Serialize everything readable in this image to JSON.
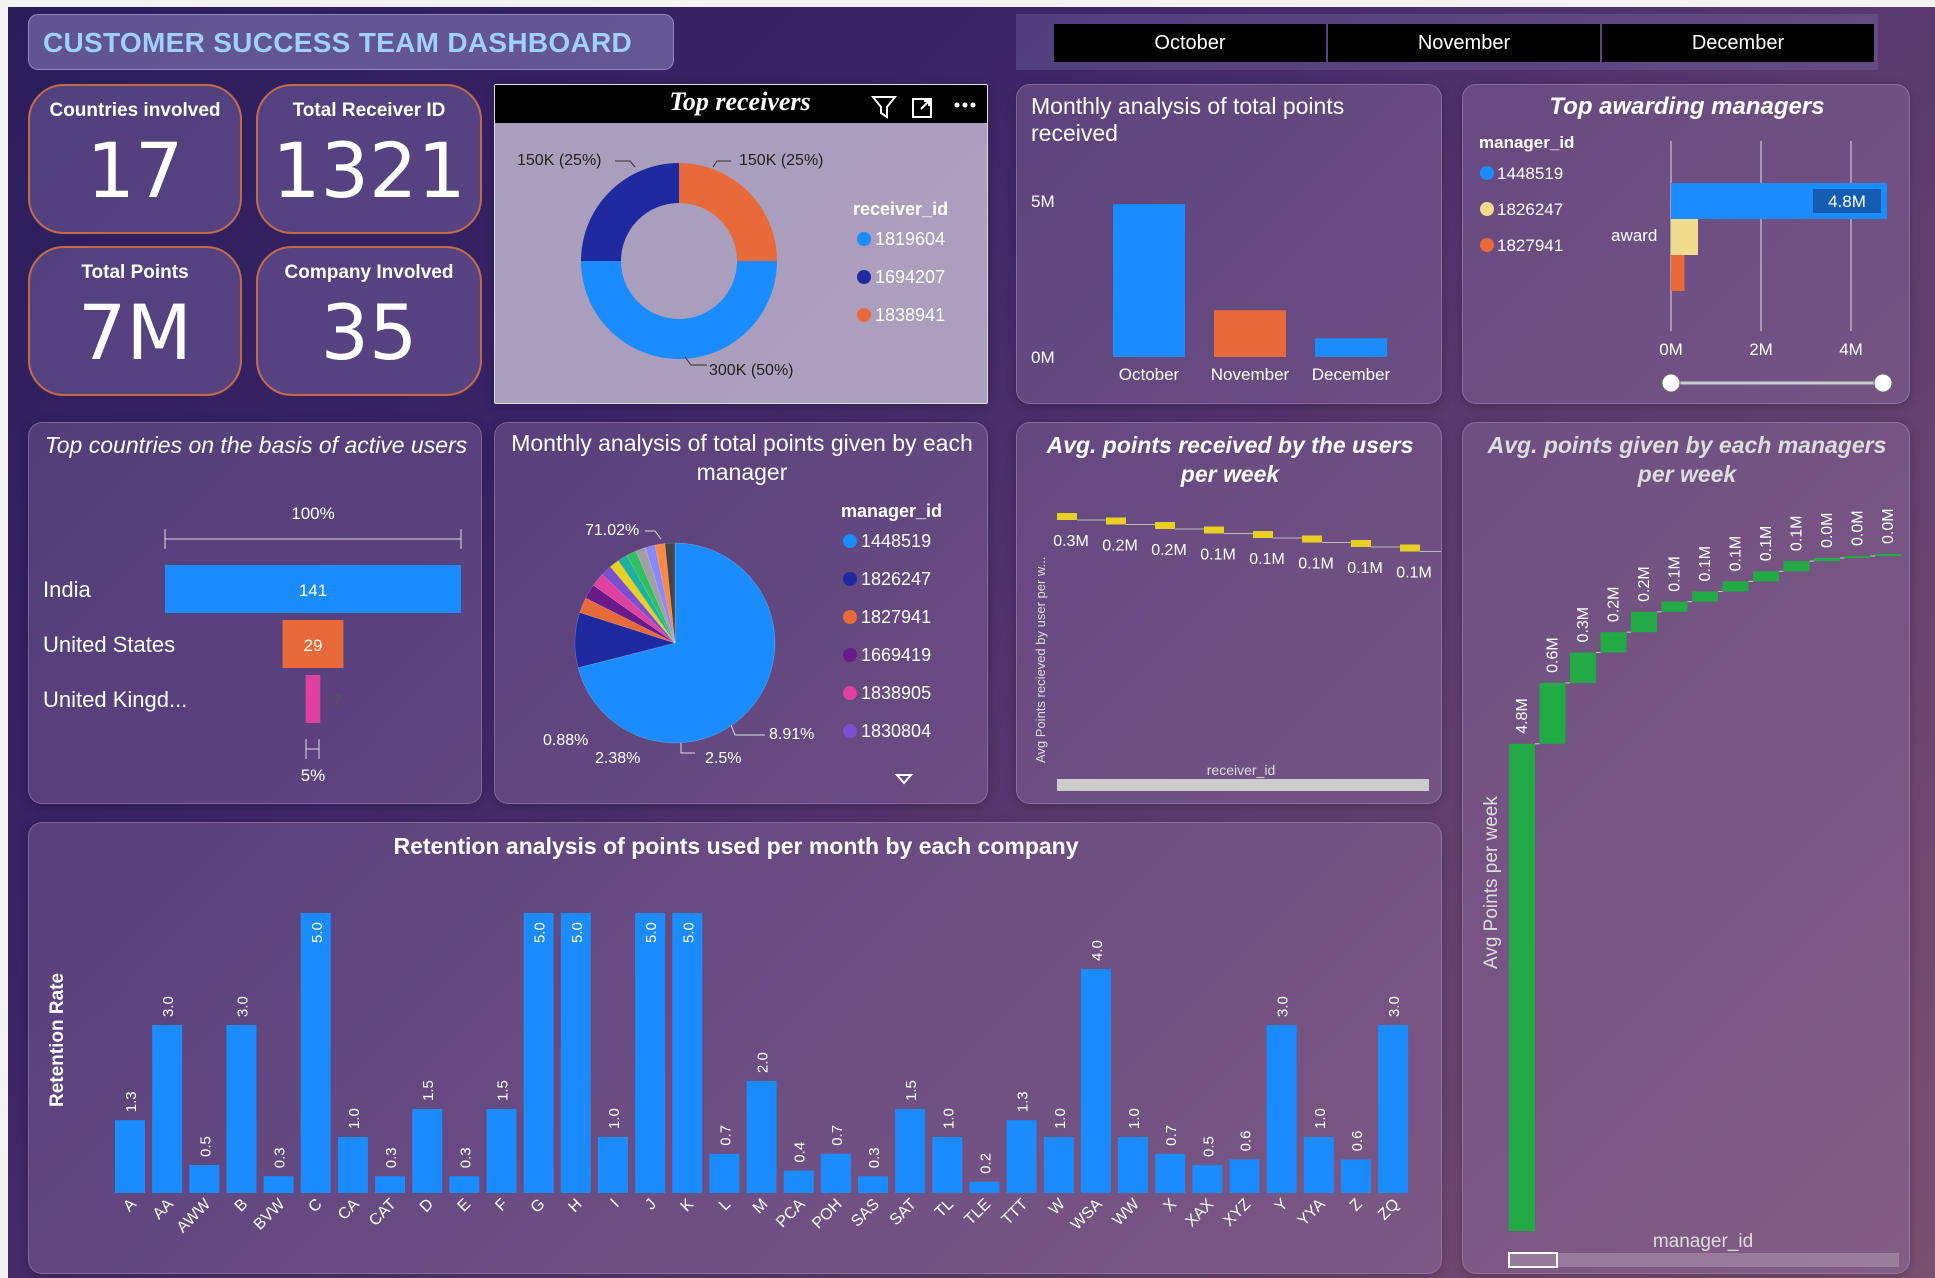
{
  "header": {
    "title": "CUSTOMER SUCCESS TEAM DASHBOARD",
    "months": [
      "October",
      "November",
      "December"
    ]
  },
  "kpis": {
    "countries": {
      "label": "Countries involved",
      "value": "17"
    },
    "receivers": {
      "label": "Total Receiver ID",
      "value": "1321"
    },
    "points": {
      "label": "Total Points",
      "value": "7M"
    },
    "companies": {
      "label": "Company Involved",
      "value": "35"
    }
  },
  "top_receivers": {
    "title": "Top receivers",
    "legend_title": "receiver_id",
    "labels": [
      "150K (25%)",
      "150K (25%)",
      "300K (50%)"
    ],
    "chart_data": {
      "type": "pie",
      "labels": [
        "1819604",
        "1694207",
        "1838941"
      ],
      "values": [
        300,
        150,
        150
      ],
      "colors": [
        "#1a8cff",
        "#1f2aa0",
        "#e8693a"
      ]
    }
  },
  "monthly_received": {
    "title": "Monthly analysis of total points received",
    "y_ticks": [
      "5M",
      "0M"
    ],
    "chart_data": {
      "type": "bar",
      "categories": [
        "October",
        "November",
        "December"
      ],
      "values": [
        4.9,
        1.5,
        0.6
      ],
      "ylim": [
        0,
        5
      ],
      "colors": [
        "#1a8cff",
        "#e8693a",
        "#1a8cff"
      ]
    }
  },
  "top_managers": {
    "title": "Top awarding managers",
    "legend_title": "manager_id",
    "ylabel": "award",
    "bar_label": "4.8M",
    "x_ticks": [
      "0M",
      "2M",
      "4M"
    ],
    "chart_data": {
      "type": "bar",
      "categories": [
        "1448519",
        "1826247",
        "1827941"
      ],
      "values": [
        4.8,
        0.6,
        0.3
      ],
      "colors": [
        "#1a8cff",
        "#f0dc8c",
        "#e8693a"
      ],
      "xlim": [
        0,
        5
      ]
    }
  },
  "countries": {
    "title": "Top countries on the basis of active users",
    "top_label": "100%",
    "bottom_label": "5%",
    "chart_data": {
      "type": "bar",
      "categories": [
        "India",
        "United States",
        "United Kingd..."
      ],
      "values": [
        141,
        29,
        7
      ],
      "colors": [
        "#1a8cff",
        "#e8693a",
        "#e040a0"
      ]
    }
  },
  "manager_pie": {
    "title": "Monthly analysis of total points given by each manager",
    "legend_title": "manager_id",
    "labels": [
      "71.02%",
      "8.91%",
      "2.5%",
      "2.38%",
      "0.88%"
    ],
    "chart_data": {
      "type": "pie",
      "labels": [
        "1448519",
        "1826247",
        "1827941",
        "1669419",
        "1838905",
        "1830804"
      ],
      "values": [
        71.02,
        8.91,
        2.5,
        2.38,
        2.2,
        1.8
      ],
      "colors": [
        "#1a8cff",
        "#1f2aa0",
        "#e8693a",
        "#6a1a8a",
        "#e040a0",
        "#7a50d0"
      ]
    }
  },
  "avg_received": {
    "title": "Avg. points received by the users per week",
    "ylabel": "Avg Points recieved by user per w...",
    "xlabel": "receiver_id",
    "chart_data": {
      "type": "bar",
      "labels": [
        "0.3M",
        "0.2M",
        "0.2M",
        "0.1M",
        "0.1M",
        "0.1M",
        "0.1M",
        "0.1M"
      ],
      "values": [
        0.3,
        0.2,
        0.2,
        0.1,
        0.1,
        0.1,
        0.1,
        0.1
      ],
      "color": "#e8d020"
    }
  },
  "avg_given": {
    "title": "Avg. points given by each managers per week",
    "ylabel": "Avg Points per week",
    "xlabel": "manager_id",
    "chart_data": {
      "type": "bar",
      "labels": [
        "4.8M",
        "0.6M",
        "0.3M",
        "0.2M",
        "0.2M",
        "0.1M",
        "0.1M",
        "0.1M",
        "0.1M",
        "0.1M",
        "0.0M",
        "0.0M",
        "0.0M"
      ],
      "values": [
        4.8,
        0.6,
        0.3,
        0.2,
        0.2,
        0.1,
        0.1,
        0.1,
        0.1,
        0.1,
        0.03,
        0.02,
        0.01
      ],
      "color": "#22aa44"
    }
  },
  "retention": {
    "title": "Retention analysis of points used per month by each company",
    "ylabel": "Retention Rate",
    "chart_data": {
      "type": "bar",
      "categories": [
        "A",
        "AA",
        "AWW",
        "B",
        "BVW",
        "C",
        "CA",
        "CAT",
        "D",
        "E",
        "F",
        "G",
        "H",
        "I",
        "J",
        "K",
        "L",
        "M",
        "PCA",
        "POH",
        "SAS",
        "SAT",
        "TL",
        "TLE",
        "TTT",
        "W",
        "WSA",
        "WW",
        "X",
        "XAX",
        "XYZ",
        "Y",
        "YYA",
        "Z",
        "ZQ"
      ],
      "values": [
        1.3,
        3.0,
        0.5,
        3.0,
        0.3,
        5.0,
        1.0,
        0.3,
        1.5,
        0.3,
        1.5,
        5.0,
        5.0,
        1.0,
        5.0,
        5.0,
        0.7,
        2.0,
        0.4,
        0.7,
        0.3,
        1.5,
        1.0,
        0.2,
        1.3,
        1.0,
        4.0,
        1.0,
        0.7,
        0.5,
        0.6,
        3.0,
        1.0,
        0.6,
        3.0
      ],
      "labels": [
        "1.3",
        "3.0",
        "0.5",
        "3.0",
        "0.3",
        "5.0",
        "1.0",
        "0.3",
        "1.5",
        "0.3",
        "1.5",
        "5.0",
        "5.0",
        "1.0",
        "5.0",
        "5.0",
        "0.7",
        "2.0",
        "0.4",
        "0.7",
        "0.3",
        "1.5",
        "1.0",
        "0.2",
        "1.3",
        "1.0",
        "4.0",
        "1.0",
        "0.7",
        "0.5",
        "0.6",
        "3.0",
        "1.0",
        "0.6",
        "3.0"
      ],
      "ylim": [
        0,
        5
      ],
      "color": "#1a8cff"
    }
  }
}
